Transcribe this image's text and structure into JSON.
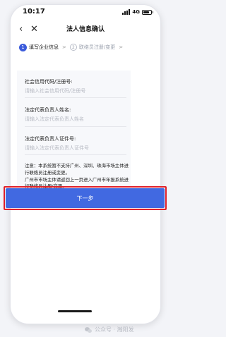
{
  "status_bar": {
    "time": "10:17",
    "network": "4G"
  },
  "nav": {
    "title": "法人信息确认",
    "back_icon": "‹",
    "close_icon": "✕"
  },
  "steps": [
    {
      "number": "1",
      "label": "填写企业信息",
      "active": true
    },
    {
      "number": "2",
      "label": "联络员注册/变更",
      "active": false
    }
  ],
  "step_separator": ">",
  "form": {
    "fields": [
      {
        "label": "社会信用代码/注册号:",
        "placeholder": "请输入社会信用代码/注册号",
        "value": ""
      },
      {
        "label": "法定代表负责人姓名:",
        "placeholder": "请输入法定代表负责人姓名",
        "value": ""
      },
      {
        "label": "法定代表负责人证件号:",
        "placeholder": "请输入法定代表负责人证件号",
        "value": ""
      }
    ],
    "notice_line1": "注意：本系统暂不支持广州、深圳、珠海市场主体进行联络员注册或变更。",
    "notice_line2": "广州市市场主体请返回上一页进入广州市年报系统进行联络员注册/变更。"
  },
  "next_button": {
    "label": "下一步"
  },
  "watermark": {
    "text": "公众号 · 瀚阳发"
  },
  "colors": {
    "primary": "#4169e1",
    "highlight_border": "#e0202a",
    "placeholder": "#b7bac3"
  }
}
